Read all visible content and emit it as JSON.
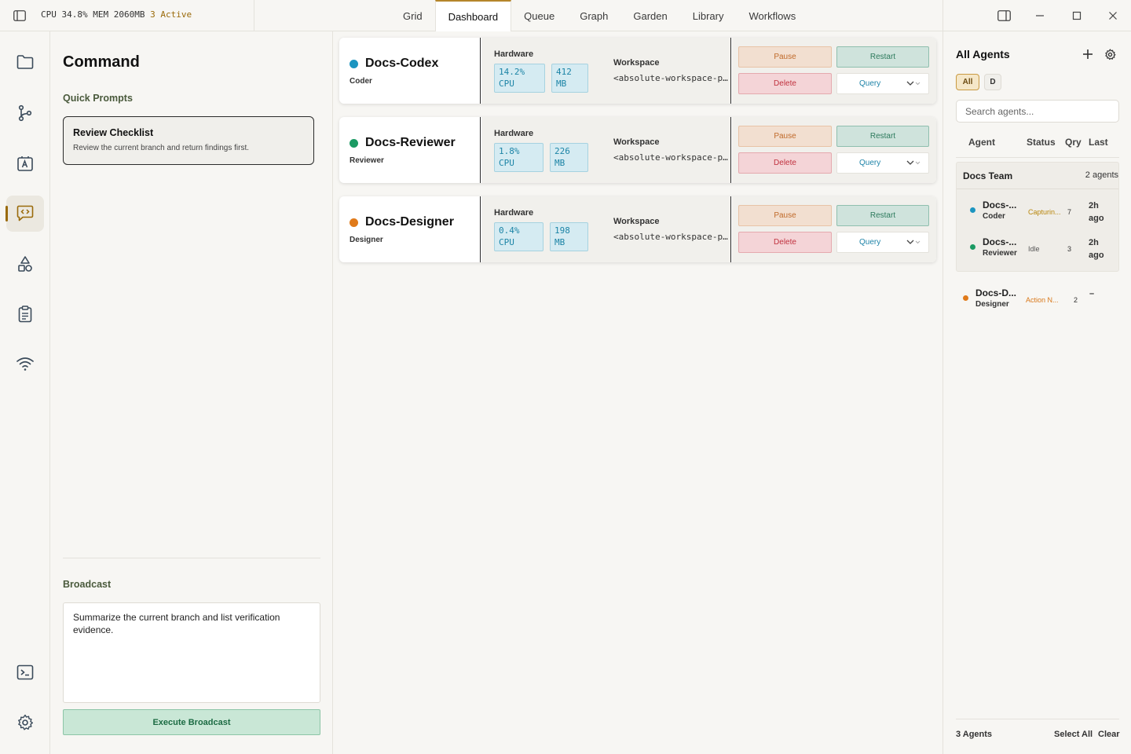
{
  "topbar": {
    "stats": {
      "cpu": "CPU 34.8%",
      "mem": "MEM 2060MB",
      "active": "3 Active"
    },
    "tabs": [
      {
        "label": "Grid",
        "active": false
      },
      {
        "label": "Dashboard",
        "active": true
      },
      {
        "label": "Queue",
        "active": false
      },
      {
        "label": "Graph",
        "active": false
      },
      {
        "label": "Garden",
        "active": false
      },
      {
        "label": "Library",
        "active": false
      },
      {
        "label": "Workflows",
        "active": false
      }
    ]
  },
  "rail": {
    "items": [
      "folder-icon",
      "git-branch-icon",
      "agent-badge-icon",
      "code-chat-icon",
      "shapes-icon",
      "clipboard-icon",
      "wifi-icon"
    ],
    "bottom": [
      "terminal-icon",
      "gear-icon"
    ],
    "active_index": 3
  },
  "command": {
    "title": "Command",
    "quick_prompts_title": "Quick Prompts",
    "prompt": {
      "title": "Review Checklist",
      "description": "Review the current branch and return findings first."
    },
    "broadcast_title": "Broadcast",
    "broadcast_text": "Summarize the current branch and list verification evidence.",
    "execute_label": "Execute Broadcast"
  },
  "cards": [
    {
      "name": "Docs-Codex",
      "role": "Coder",
      "dot_color": "#1c95c0",
      "hw_label": "Hardware",
      "cpu_value": "14.2%",
      "cpu_unit": "CPU",
      "mem_value": "412",
      "mem_unit": "MB",
      "ws_label": "Workspace",
      "ws_path": "<absolute-workspace-path>",
      "pause": "Pause",
      "restart": "Restart",
      "delete": "Delete",
      "query": "Query"
    },
    {
      "name": "Docs-Reviewer",
      "role": "Reviewer",
      "dot_color": "#1b9a63",
      "hw_label": "Hardware",
      "cpu_value": "1.8%",
      "cpu_unit": "CPU",
      "mem_value": "226",
      "mem_unit": "MB",
      "ws_label": "Workspace",
      "ws_path": "<absolute-workspace-path>",
      "pause": "Pause",
      "restart": "Restart",
      "delete": "Delete",
      "query": "Query"
    },
    {
      "name": "Docs-Designer",
      "role": "Designer",
      "dot_color": "#e07a1a",
      "hw_label": "Hardware",
      "cpu_value": "0.4%",
      "cpu_unit": "CPU",
      "mem_value": "198",
      "mem_unit": "MB",
      "ws_label": "Workspace",
      "ws_path": "<absolute-workspace-path>",
      "pause": "Pause",
      "restart": "Restart",
      "delete": "Delete",
      "query": "Query"
    }
  ],
  "agents_panel": {
    "title": "All Agents",
    "filters": [
      "All",
      "D"
    ],
    "search_placeholder": "Search agents...",
    "columns": [
      "Agent",
      "Status",
      "Qry",
      "Last"
    ],
    "group": {
      "name": "Docs Team",
      "count": "2 agents"
    },
    "rows": [
      {
        "name": "Docs-...",
        "role": "Coder",
        "status": "Capturin...",
        "status_color": "#b8860b",
        "qry": "7",
        "last": "2h ago",
        "dot_color": "#1c95c0"
      },
      {
        "name": "Docs-...",
        "role": "Reviewer",
        "status": "Idle",
        "status_color": "#555555",
        "qry": "3",
        "last": "2h ago",
        "dot_color": "#1b9a63"
      },
      {
        "name": "Docs-D...",
        "role": "Designer",
        "status": "Action N...",
        "status_color": "#d9781a",
        "qry": "2",
        "last": "–",
        "dot_color": "#e07a1a"
      }
    ],
    "footer": {
      "count": "3 Agents",
      "select_all": "Select All",
      "clear": "Clear"
    }
  }
}
